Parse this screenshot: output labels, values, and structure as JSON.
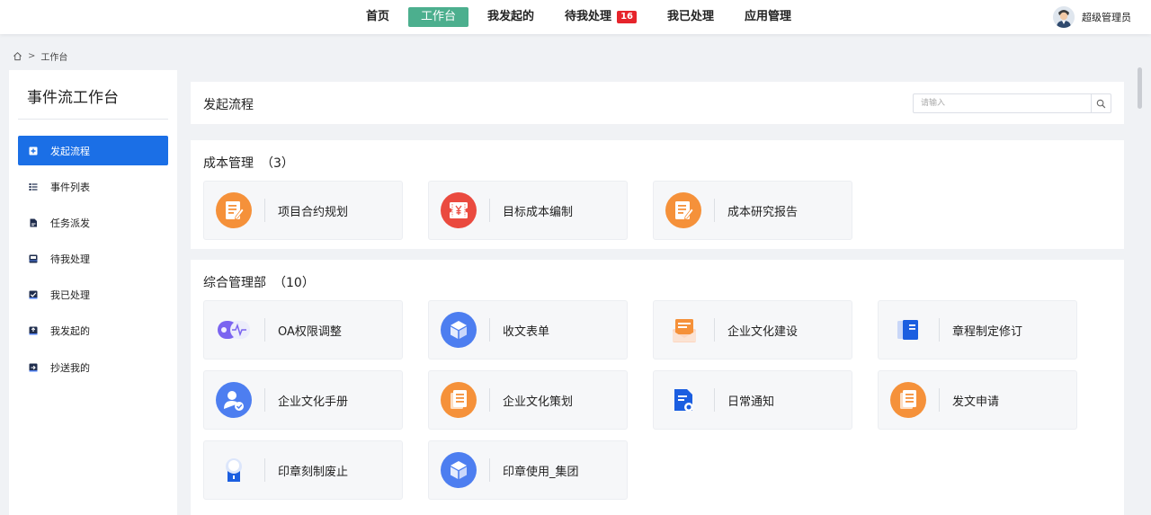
{
  "nav": {
    "items": [
      {
        "label": "首页",
        "active": false
      },
      {
        "label": "工作台",
        "active": true
      },
      {
        "label": "我发起的",
        "active": false
      },
      {
        "label": "待我处理",
        "active": false,
        "badge": "16"
      },
      {
        "label": "我已处理",
        "active": false
      },
      {
        "label": "应用管理",
        "active": false
      }
    ],
    "user_name": "超级管理员"
  },
  "breadcrumb": {
    "home_icon": "home-icon",
    "separator": ">",
    "current": "工作台"
  },
  "sidebar": {
    "title": "事件流工作台",
    "items": [
      {
        "label": "发起流程",
        "icon": "plus-square-icon",
        "active": true
      },
      {
        "label": "事件列表",
        "icon": "list-icon",
        "active": false
      },
      {
        "label": "任务派发",
        "icon": "document-icon",
        "active": false
      },
      {
        "label": "待我处理",
        "icon": "inbox-icon",
        "active": false
      },
      {
        "label": "我已处理",
        "icon": "check-box-icon",
        "active": false
      },
      {
        "label": "我发起的",
        "icon": "send-box-icon",
        "active": false
      },
      {
        "label": "抄送我的",
        "icon": "cc-box-icon",
        "active": false
      }
    ]
  },
  "launch": {
    "title": "发起流程",
    "search_placeholder": "请输入"
  },
  "groups": [
    {
      "title": "成本管理",
      "count": "（3）",
      "items": [
        {
          "label": "项目合约规划",
          "icon": "edit-doc-icon"
        },
        {
          "label": "目标成本编制",
          "icon": "coupon-icon"
        },
        {
          "label": "成本研究报告",
          "icon": "edit-doc-icon"
        }
      ]
    },
    {
      "title": "综合管理部",
      "count": "（10）",
      "items": [
        {
          "label": "OA权限调整",
          "icon": "toggle-pulse-icon"
        },
        {
          "label": "收文表单",
          "icon": "cube-icon"
        },
        {
          "label": "企业文化建设",
          "icon": "mail-envelope-icon"
        },
        {
          "label": "章程制定修订",
          "icon": "book-icon"
        },
        {
          "label": "企业文化手册",
          "icon": "user-check-icon"
        },
        {
          "label": "企业文化策划",
          "icon": "file-lines-icon"
        },
        {
          "label": "日常通知",
          "icon": "file-badge-icon"
        },
        {
          "label": "发文申请",
          "icon": "file-lines-icon"
        },
        {
          "label": "印章刻制废止",
          "icon": "seal-person-icon"
        },
        {
          "label": "印章使用_集团",
          "icon": "cube-icon"
        }
      ]
    }
  ],
  "colors": {
    "primary": "#1b6fe6",
    "nav_active": "#4caf8e",
    "badge": "#e6242b",
    "orange": "#f5913a",
    "red": "#ea4a3f",
    "blue": "#4d7ef0"
  }
}
